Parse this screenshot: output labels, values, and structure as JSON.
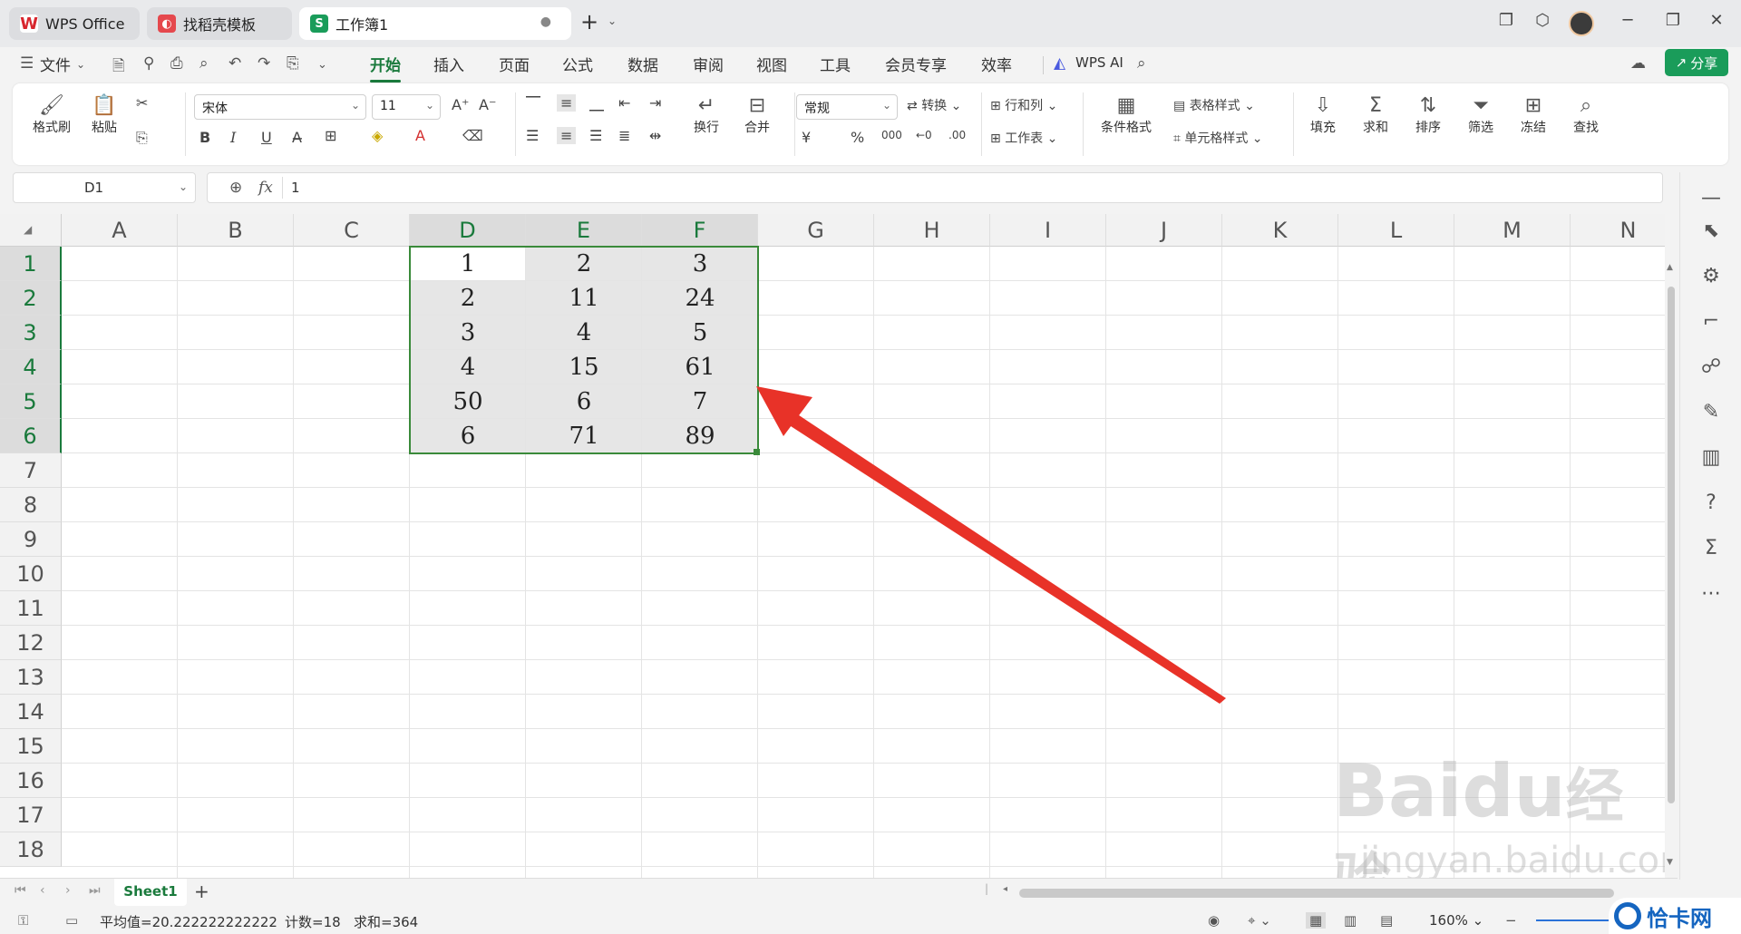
{
  "tabs": [
    {
      "label": "WPS Office",
      "icon": "wps-logo-icon"
    },
    {
      "label": "找稻壳模板",
      "icon": "docer-icon"
    },
    {
      "label": "工作簿1",
      "icon": "spreadsheet-icon"
    }
  ],
  "menu": {
    "file": "文件",
    "items": [
      "开始",
      "插入",
      "页面",
      "公式",
      "数据",
      "审阅",
      "视图",
      "工具",
      "会员专享",
      "效率"
    ],
    "active": "开始",
    "ai": "WPS AI",
    "share": "分享"
  },
  "ribbon": {
    "format_painter": "格式刷",
    "paste": "粘贴",
    "font_name": "宋体",
    "font_size": "11",
    "wrap": "换行",
    "merge": "合并",
    "number_format": "常规",
    "convert": "转换",
    "row_col": "行和列",
    "worksheet": "工作表",
    "cond_format": "条件格式",
    "table_style": "表格样式",
    "cell_style": "单元格样式",
    "fill": "填充",
    "sum": "求和",
    "sort": "排序",
    "filter": "筛选",
    "freeze": "冻结",
    "find": "查找",
    "bold": "B",
    "italic": "I",
    "underline": "U"
  },
  "formula_bar": {
    "name_box": "D1",
    "fx": "fx",
    "content": "1"
  },
  "columns": [
    "A",
    "B",
    "C",
    "D",
    "E",
    "F",
    "G",
    "H",
    "I",
    "J",
    "K",
    "L",
    "M",
    "N"
  ],
  "rows": [
    "1",
    "2",
    "3",
    "4",
    "5",
    "6",
    "7",
    "8",
    "9",
    "10",
    "11",
    "12",
    "13",
    "14",
    "15",
    "16",
    "17",
    "18"
  ],
  "cells": [
    [
      "1",
      "2",
      "3"
    ],
    [
      "2",
      "11",
      "24"
    ],
    [
      "3",
      "4",
      "5"
    ],
    [
      "4",
      "15",
      "61"
    ],
    [
      "50",
      "6",
      "7"
    ],
    [
      "6",
      "71",
      "89"
    ]
  ],
  "sheet": {
    "name": "Sheet1",
    "add": "+"
  },
  "status": {
    "average": "平均值=20.222222222222",
    "count": "计数=18",
    "sum": "求和=364",
    "zoom": "160%"
  },
  "watermark": {
    "brand": "Baidu",
    "brand_cn": "经验",
    "url": "jingyan.baidu.com"
  },
  "corner_logo": "恰卡网",
  "colors": {
    "accent": "#1a7a3c",
    "share": "#1a9c5a",
    "arrow": "#e83228",
    "selection_border": "#3a8a3a"
  }
}
